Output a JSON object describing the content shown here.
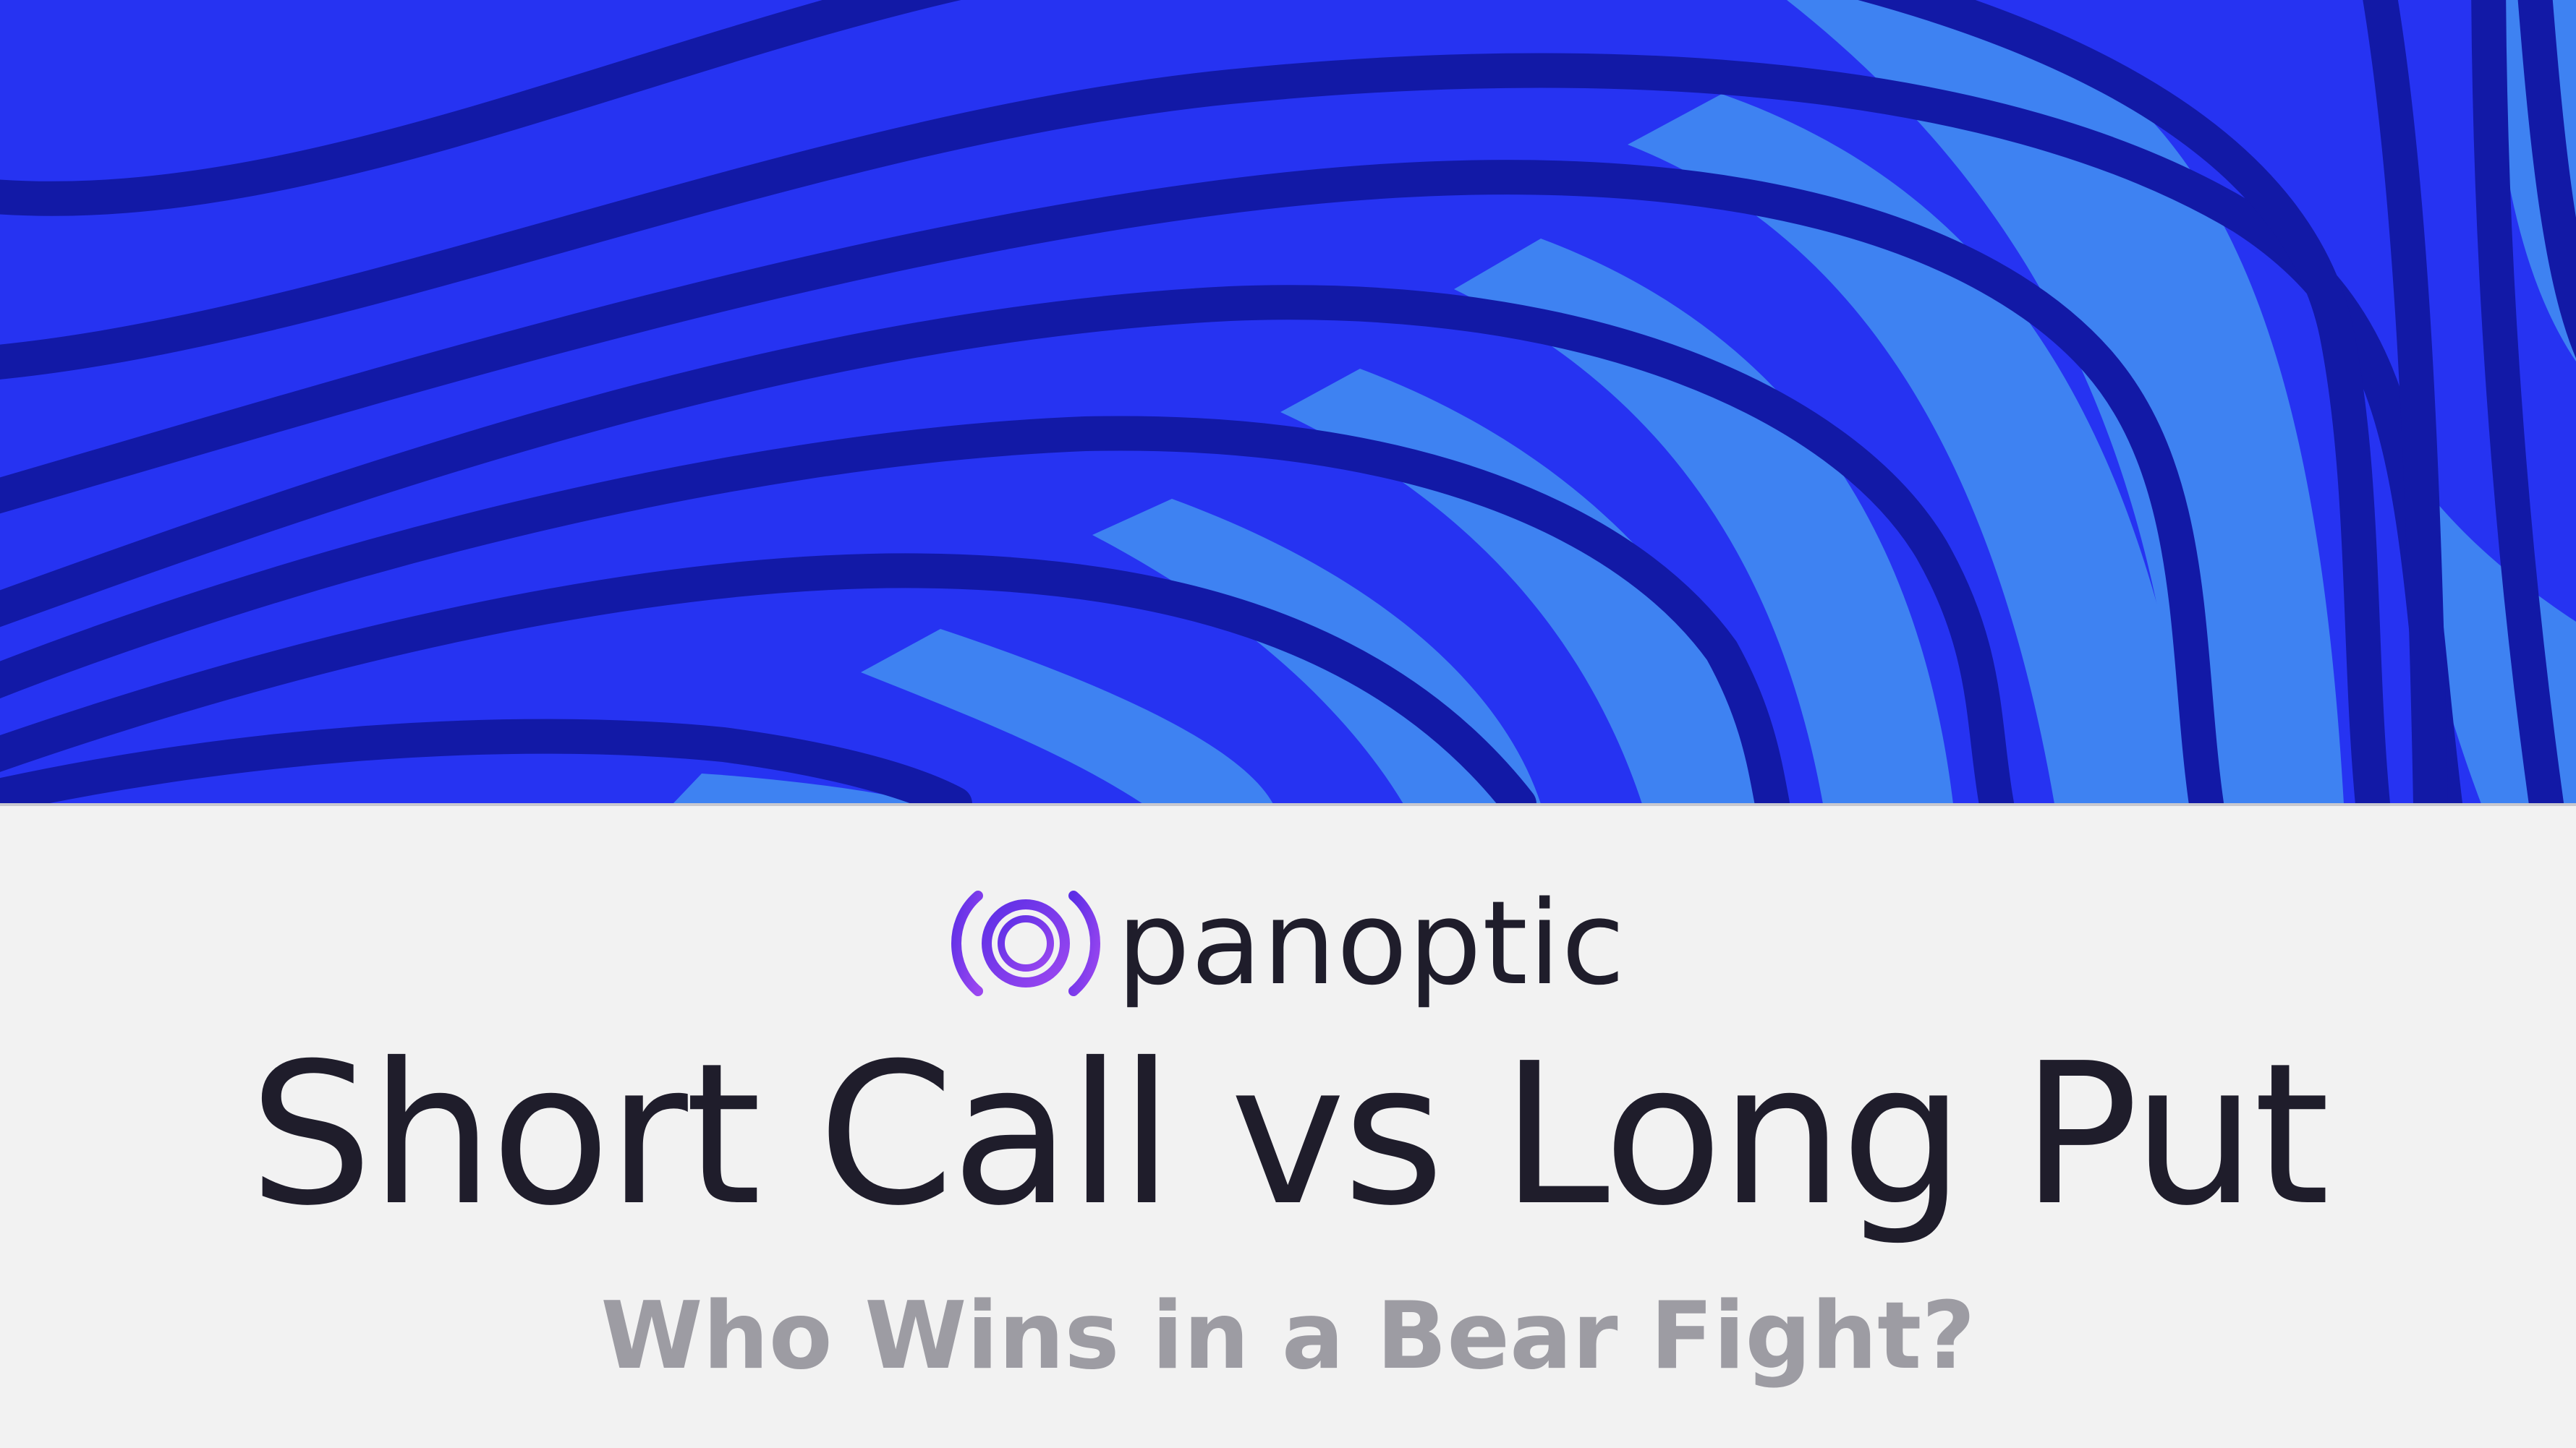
{
  "brand": {
    "name": "panoptic",
    "logo_icon": "panoptic-ring-logo-icon"
  },
  "headline": "Short Call vs Long Put",
  "subheadline": "Who Wins in a Bear Fight?",
  "colors": {
    "banner_background": "#2633f2",
    "banner_stripe_dark": "#1219a6",
    "banner_stripe_light": "#3e82f2",
    "logo_gradient_start": "#5d2fe6",
    "logo_gradient_end": "#9b47f0",
    "title_text": "#1f1d2b",
    "subtitle_text": "#9d9ca3",
    "page_background": "#f2f2f2"
  }
}
